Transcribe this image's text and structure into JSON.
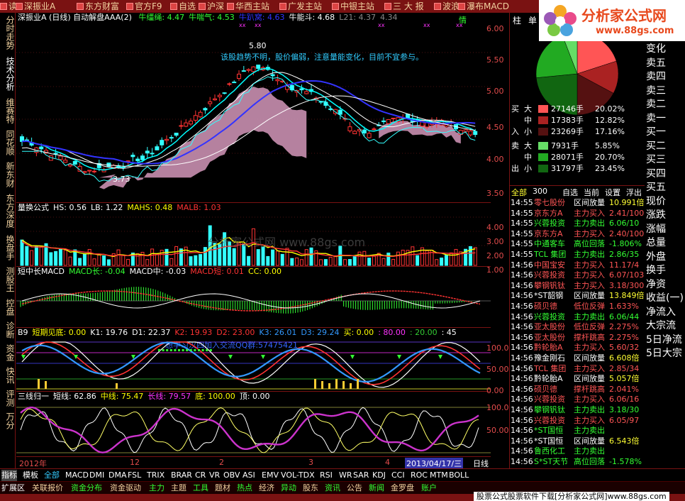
{
  "topbar": {
    "items": [
      "读",
      "深振业A",
      "东方财富",
      "官方F9",
      "自选",
      "沪深",
      "华西主站",
      "广发主站",
      "中银主站",
      "三 大 报",
      "波浪",
      "瀑布MACD"
    ]
  },
  "leftnav": {
    "tabs": [
      "分时走势",
      "技术分析",
      "维赛特",
      "同花顺",
      "新东财",
      "东方深度",
      "换盘手",
      "测股王",
      "控盘",
      "诊断",
      "资金",
      "快讯",
      "评测",
      "万分"
    ]
  },
  "main": {
    "title": "深振业A (日线) 自动解盘AAA(2)",
    "indicators": [
      {
        "label": "牛缰绳: 4.47",
        "color": "#33ff33"
      },
      {
        "label": "牛喘气: 4.53",
        "color": "#33ff33"
      },
      {
        "label": "牛趴窝: 4.63",
        "color": "#3333ff"
      },
      {
        "label": "牛能斗: 4.68",
        "color": "#ffffff"
      },
      {
        "label": "L21: 4.37",
        "color": "#888888"
      },
      {
        "label": "4.34",
        "color": "#888888"
      }
    ],
    "qing": "情",
    "annotation": "该股趋势不明，股价偏弱，注意量能变化，目前不宜参与。",
    "high_label": "5.80",
    "low_label": "3.73",
    "yticks": [
      "6.00",
      "5.50",
      "5.00",
      "4.50",
      "4.00",
      "3.50"
    ]
  },
  "volpanel": {
    "title": "量换公式",
    "items": [
      {
        "label": "HS: 0.56",
        "color": "#ffffff"
      },
      {
        "label": "LB: 1.22",
        "color": "#ffffff"
      },
      {
        "label": "MAHS: 0.48",
        "color": "#ffff00"
      },
      {
        "label": "MALB: 1.03",
        "color": "#ff3333"
      }
    ],
    "yticks": [
      "4.00",
      "3.00",
      "2.00",
      "1.00"
    ],
    "watermark": "分析家公式网  www.88gs.com"
  },
  "macdpanel": {
    "title": "短中长MACD",
    "items": [
      {
        "label": "MACD长: -0.04",
        "color": "#33ff33"
      },
      {
        "label": "MACD中: -0.03",
        "color": "#ffffff"
      },
      {
        "label": "MACD短: 0.01",
        "color": "#ff3333"
      },
      {
        "label": "CC: 0.00",
        "color": "#ffff00"
      }
    ]
  },
  "kdjpanel": {
    "items": [
      {
        "label": "B9",
        "color": "#ffffff"
      },
      {
        "label": "短期见底: 0.00",
        "color": "#ffff00"
      },
      {
        "label": "K1: 19.76",
        "color": "#ffffff"
      },
      {
        "label": "D1: 22.37",
        "color": "#ffffff"
      },
      {
        "label": "K2: 19.93",
        "color": "#ff3333"
      },
      {
        "label": "D2: 23.00",
        "color": "#ff3333"
      },
      {
        "label": "K3: 26.01",
        "color": "#3399ff"
      },
      {
        "label": "D3: 29.24",
        "color": "#3399ff"
      },
      {
        "label": "买: 0.00",
        "color": "#ffff00"
      },
      {
        "label": ": 80.00",
        "color": "#ff33ff"
      },
      {
        "label": ": 20.00",
        "color": "#33cc33"
      },
      {
        "label": ": 45",
        "color": "#ffffff"
      }
    ],
    "banner": "想学习汉四加入交流QQ群:57475421",
    "yticks": [
      "100.00",
      "50.00",
      "0.00"
    ]
  },
  "sxpanel": {
    "items": [
      {
        "label": "三线归一",
        "color": "#ffffff"
      },
      {
        "label": "短线: 62.86",
        "color": "#ffffff"
      },
      {
        "label": "中线: 75.47",
        "color": "#ffff00"
      },
      {
        "label": "长线: 79.57",
        "color": "#ff33ff"
      },
      {
        "label": "底: 100.00",
        "color": "#ffff00"
      },
      {
        "label": "顶: 0.00",
        "color": "#ffffff"
      }
    ],
    "yticks": [
      "100.00",
      "50.00"
    ]
  },
  "timeaxis": {
    "labels": [
      "2012年",
      "12",
      "2",
      "3",
      "4"
    ],
    "current": "2013/04/17/三",
    "period": "日线"
  },
  "right": {
    "header": [
      "柱",
      "单",
      "亿"
    ],
    "sidebar_labels": [
      "变化",
      "卖五",
      "卖四",
      "卖三",
      "卖二",
      "卖一",
      "买一",
      "买二",
      "买三",
      "买四",
      "买五",
      "现价",
      "涨跌",
      "涨幅",
      "总量",
      "外盘",
      "换手",
      "净资",
      "收益(一)",
      "净流入",
      "大宗流",
      "5日净流",
      "5日大宗"
    ],
    "flows": [
      {
        "side": "买",
        "size": "大",
        "value": "27146手",
        "pct": "20.02%",
        "color": "#ff5555"
      },
      {
        "side": "",
        "size": "中",
        "value": "17383手",
        "pct": "12.82%",
        "color": "#aa2222"
      },
      {
        "side": "入",
        "size": "小",
        "value": "23269手",
        "pct": "17.16%",
        "color": "#551111"
      },
      {
        "side": "卖",
        "size": "大",
        "value": "7931手",
        "pct": "5.85%",
        "color": "#66dd66"
      },
      {
        "side": "",
        "size": "中",
        "value": "28071手",
        "pct": "20.70%",
        "color": "#22aa22"
      },
      {
        "side": "出",
        "size": "小",
        "value": "31797手",
        "pct": "23.45%",
        "color": "#116611"
      }
    ],
    "tabs": [
      "全部",
      "300",
      "自选",
      "当前",
      "设置",
      "浮出",
      "扩"
    ],
    "ticks": [
      {
        "t": "14:55",
        "name": "零七股份",
        "act": "区间放量",
        "val": "10.991倍",
        "nc": "#ff5555",
        "ac": "#ffffff",
        "vc": "#ffff33"
      },
      {
        "t": "14:55",
        "name": "京东方A",
        "act": "主力买入",
        "val": "2.41/100",
        "nc": "#ff5555",
        "ac": "#ff5555",
        "vc": "#ff5555"
      },
      {
        "t": "14:55",
        "name": "兴蓉投资",
        "act": "主力卖出",
        "val": "6.06/10",
        "nc": "#33ff33",
        "ac": "#33ff33",
        "vc": "#33ff33"
      },
      {
        "t": "14:55",
        "name": "京东方A",
        "act": "主力买入",
        "val": "2.40/100",
        "nc": "#ff5555",
        "ac": "#ff5555",
        "vc": "#ff5555"
      },
      {
        "t": "14:55",
        "name": "中通客车",
        "act": "高位回落",
        "val": "-1.806%",
        "nc": "#33ff33",
        "ac": "#33ff33",
        "vc": "#33ff33"
      },
      {
        "t": "14:55",
        "name": "TCL 集团",
        "act": "主力卖出",
        "val": "2.86/35",
        "nc": "#33ff33",
        "ac": "#33ff33",
        "vc": "#33ff33"
      },
      {
        "t": "14:56",
        "name": "中国宝安",
        "act": "主力买入",
        "val": "11.17/4",
        "nc": "#ff5555",
        "ac": "#ff5555",
        "vc": "#ff5555"
      },
      {
        "t": "14:56",
        "name": "兴蓉投资",
        "act": "主力买入",
        "val": "6.07/103",
        "nc": "#ff5555",
        "ac": "#ff5555",
        "vc": "#ff5555"
      },
      {
        "t": "14:56",
        "name": "攀钢钒钛",
        "act": "主力买入",
        "val": "3.18/300",
        "nc": "#ff5555",
        "ac": "#ff5555",
        "vc": "#ff5555"
      },
      {
        "t": "14:56",
        "name": "*ST韶钢",
        "act": "区间放量",
        "val": "13.849倍",
        "nc": "#ffffff",
        "ac": "#ffffff",
        "vc": "#ffff33"
      },
      {
        "t": "14:56",
        "name": "硕贝德",
        "act": "低位反弹",
        "val": "1.633%",
        "nc": "#ff5555",
        "ac": "#ff5555",
        "vc": "#ff5555"
      },
      {
        "t": "14:56",
        "name": "兴蓉投资",
        "act": "主力卖出",
        "val": "6.06/44",
        "nc": "#33ff33",
        "ac": "#33ff33",
        "vc": "#33ff33"
      },
      {
        "t": "14:56",
        "name": "亚太股份",
        "act": "低位反弹",
        "val": "2.275%",
        "nc": "#ff5555",
        "ac": "#ff5555",
        "vc": "#ff5555"
      },
      {
        "t": "14:56",
        "name": "亚太股份",
        "act": "撑杆跳高",
        "val": "2.275%",
        "nc": "#ff5555",
        "ac": "#ff5555",
        "vc": "#ff5555"
      },
      {
        "t": "14:56",
        "name": "黔轮胎A",
        "act": "主力买入",
        "val": "5.60/32",
        "nc": "#ff5555",
        "ac": "#ff5555",
        "vc": "#ff5555"
      },
      {
        "t": "14:56",
        "name": "豫金刚石",
        "act": "区间放量",
        "val": "6.608倍",
        "nc": "#ffffff",
        "ac": "#ffffff",
        "vc": "#ffff33"
      },
      {
        "t": "14:56",
        "name": "TCL 集团",
        "act": "主力买入",
        "val": "2.85/34",
        "nc": "#ff5555",
        "ac": "#ff5555",
        "vc": "#ff5555"
      },
      {
        "t": "14:56",
        "name": "黔轮胎A",
        "act": "区间放量",
        "val": "5.057倍",
        "nc": "#ffffff",
        "ac": "#ffffff",
        "vc": "#ffff33"
      },
      {
        "t": "14:56",
        "name": "硕贝德",
        "act": "撑杆跳高",
        "val": "2.041%",
        "nc": "#ff5555",
        "ac": "#ff5555",
        "vc": "#ff5555"
      },
      {
        "t": "14:56",
        "name": "兴蓉投资",
        "act": "主力买入",
        "val": "6.06/16",
        "nc": "#ff5555",
        "ac": "#ff5555",
        "vc": "#ff5555"
      },
      {
        "t": "14:56",
        "name": "攀钢钒钛",
        "act": "主力卖出",
        "val": "3.18/30",
        "nc": "#33ff33",
        "ac": "#33ff33",
        "vc": "#33ff33"
      },
      {
        "t": "14:56",
        "name": "兴蓉投资",
        "act": "主力买入",
        "val": "6.05/97",
        "nc": "#ff5555",
        "ac": "#ff5555",
        "vc": "#ff5555"
      },
      {
        "t": "14:56",
        "name": "*ST国恒",
        "act": "主力卖出",
        "val": "",
        "nc": "#33ff33",
        "ac": "#33ff33",
        "vc": "#33ff33"
      },
      {
        "t": "14:56",
        "name": "*ST国恒",
        "act": "区间放量",
        "val": "6.543倍",
        "nc": "#ffffff",
        "ac": "#ffffff",
        "vc": "#ffff33"
      },
      {
        "t": "14:56",
        "name": "鲁西化工",
        "act": "主力卖出",
        "val": "",
        "nc": "#33ff33",
        "ac": "#33ff33",
        "vc": "#33ff33"
      },
      {
        "t": "14:56",
        "name": "S*ST天节",
        "act": "高位回落",
        "val": "-1.578%",
        "nc": "#33ff33",
        "ac": "#33ff33",
        "vc": "#33ff33"
      }
    ]
  },
  "bottom": {
    "indicators": [
      "指标",
      "模板",
      "全部",
      "MACD",
      "DMI",
      "DMA",
      "FSL",
      "TRIX",
      "BRAR",
      "CR",
      "VR",
      "OBV",
      "ASI",
      "EMV",
      "VOL-TDX",
      "RSI",
      "WR",
      "SAR",
      "KDJ",
      "CCI",
      "ROC",
      "MTM",
      "BOLL"
    ],
    "menus": [
      "扩展区",
      "关联报价",
      "资金分布",
      "资金驱动",
      "主力",
      "主题",
      "工具",
      "题材",
      "热点",
      "经济",
      "异动",
      "股东",
      "资讯",
      "公告",
      "新闻",
      "金罗盘",
      "账户"
    ],
    "footer": "股票公式股票软件下载[分析家公式网]www.88gs.com"
  },
  "logo": {
    "name": "分析家公式网",
    "url": "www.88gs.com"
  }
}
